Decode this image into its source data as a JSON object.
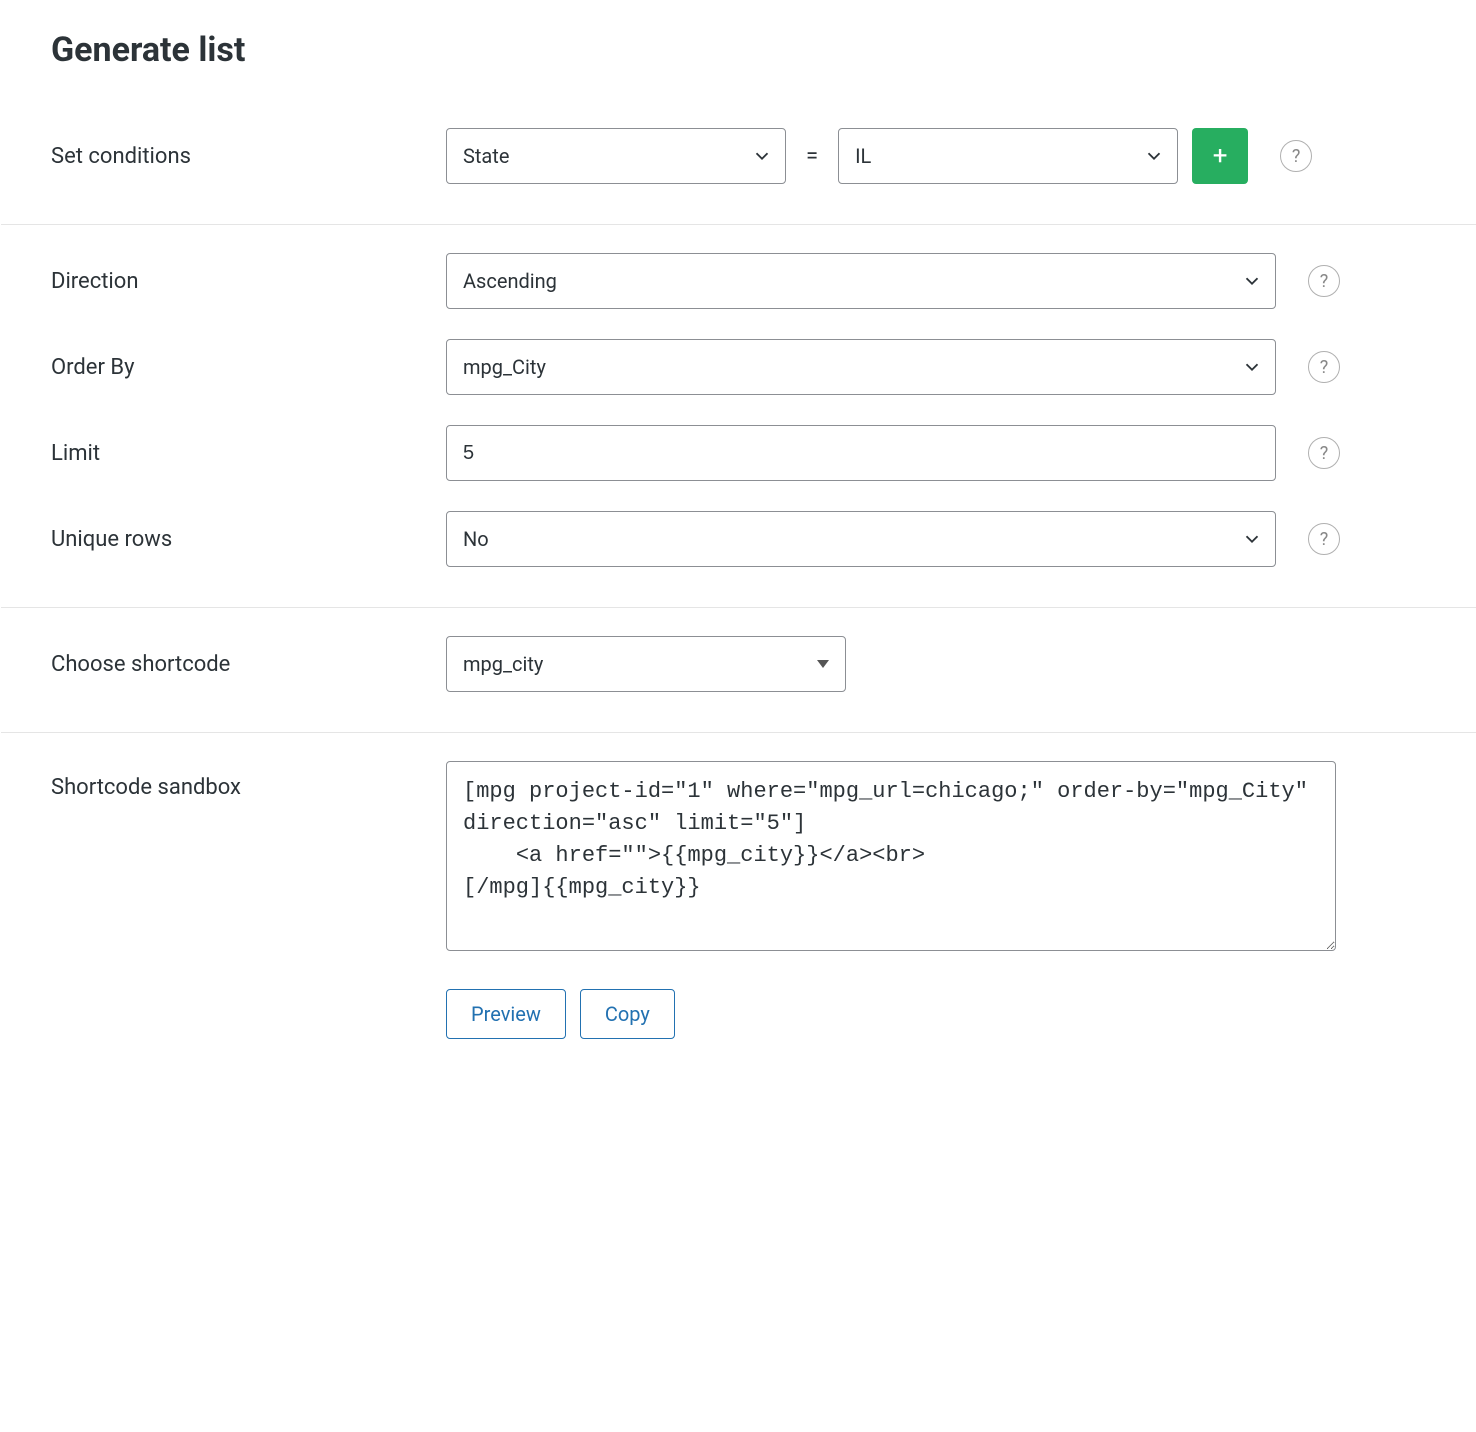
{
  "title": "Generate list",
  "conditions": {
    "label": "Set conditions",
    "field_select": "State",
    "operator": "=",
    "value_select": "IL",
    "add_symbol": "+"
  },
  "direction": {
    "label": "Direction",
    "value": "Ascending"
  },
  "order_by": {
    "label": "Order By",
    "value": "mpg_City"
  },
  "limit": {
    "label": "Limit",
    "value": "5"
  },
  "unique_rows": {
    "label": "Unique rows",
    "value": "No"
  },
  "choose_shortcode": {
    "label": "Choose shortcode",
    "value": "mpg_city"
  },
  "sandbox": {
    "label": "Shortcode sandbox",
    "content": "[mpg project-id=\"1\" where=\"mpg_url=chicago;\" order-by=\"mpg_City\" direction=\"asc\" limit=\"5\"]\n    <a href=\"\">{{mpg_city}}</a><br>\n[/mpg]{{mpg_city}}"
  },
  "buttons": {
    "preview": "Preview",
    "copy": "Copy"
  },
  "help_tooltip": "?"
}
